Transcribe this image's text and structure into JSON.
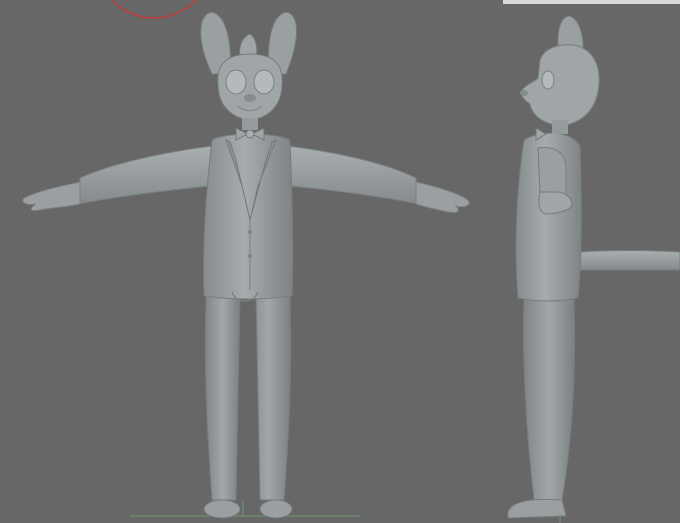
{
  "viewport": {
    "background": "#676767",
    "model_color": "#9aa0a1",
    "model_shadow": "#6f7677",
    "model_highlight": "#b8bebf",
    "gizmo_color": "#c0393b",
    "ground_line_color": "#6c9a6c"
  },
  "views": [
    {
      "id": "front",
      "icon": "character-front-view"
    },
    {
      "id": "side",
      "icon": "character-side-view"
    }
  ]
}
